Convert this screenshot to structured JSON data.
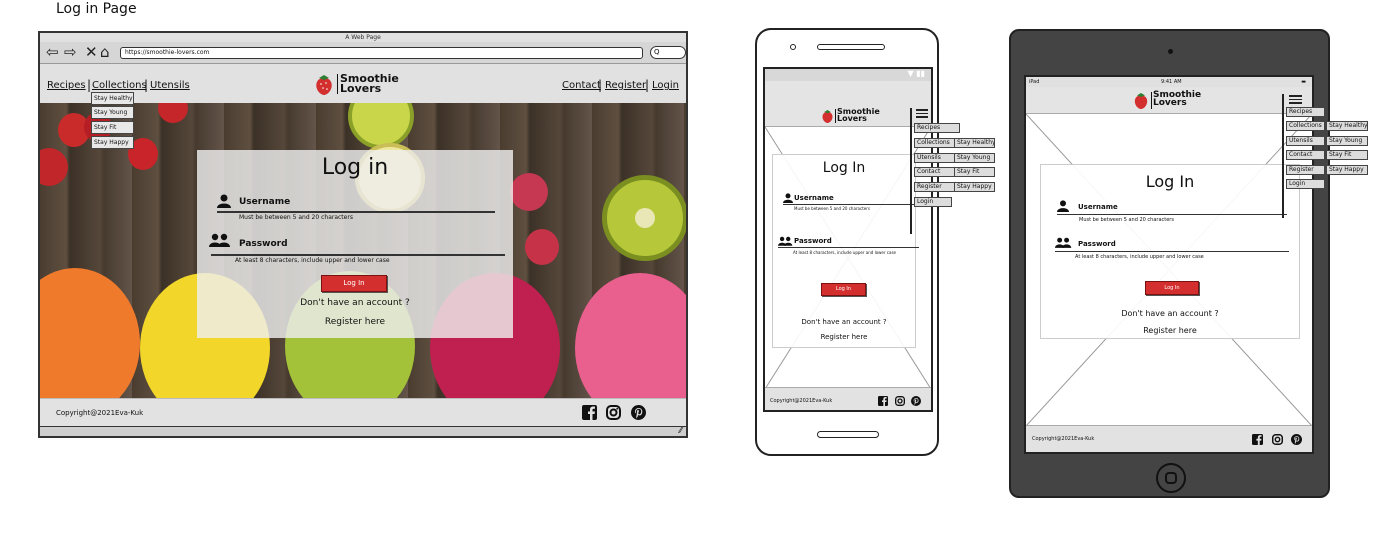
{
  "page": {
    "heading": "Log in Page"
  },
  "desktop": {
    "window_title": "A Web Page",
    "url": "https://smoothie-lovers.com",
    "search_glyph": "Q",
    "nav_left": [
      "Recipes",
      "Collections",
      "Utensils"
    ],
    "nav_right": [
      "Contact",
      "Register",
      "Login"
    ],
    "logo_line1": "Smoothie",
    "logo_line2": "Lovers",
    "submenu": [
      "Stay Healthy",
      "Stay Young",
      "Stay Fit",
      "Stay Happy"
    ],
    "login": {
      "title": "Log in",
      "username_label": "Username",
      "username_hint": "Must be between 5 and 20 characters",
      "password_label": "Password",
      "password_hint": "At least 8 characters, include upper and lower case",
      "button_label": "Log In",
      "no_account_text": "Don't have an account ?",
      "register_link": "Register here"
    },
    "footer_copyright": "Copyright@2021Eva-Kuk",
    "social_icons": [
      "facebook-icon",
      "instagram-icon",
      "pinterest-icon"
    ]
  },
  "phone": {
    "logo_line1": "Smoothie",
    "logo_line2": "Lovers",
    "menu": [
      "Recipes",
      "Collections",
      "Utensils",
      "Contact",
      "Register",
      "Login"
    ],
    "submenu": [
      "Stay Healthy",
      "Stay Young",
      "Stay Fit",
      "Stay Happy"
    ],
    "login": {
      "title": "Log In",
      "username_label": "Username",
      "username_hint": "Must be between 5 and 20 characters",
      "password_label": "Password",
      "password_hint": "At least 8 characters, include upper and lower case",
      "button_label": "Log In",
      "no_account_text": "Don't have an account ?",
      "register_link": "Register here"
    },
    "footer_copyright": "Copyright@2021Eva-Kuk"
  },
  "tablet": {
    "status_left": "iPad",
    "status_time": "9:41 AM",
    "logo_line1": "Smoothie",
    "logo_line2": "Lovers",
    "menu": [
      "Recipes",
      "Collections",
      "Utensils",
      "Contact",
      "Register",
      "Login"
    ],
    "submenu": [
      "Stay Healthy",
      "Stay Young",
      "Stay Fit",
      "Stay Happy"
    ],
    "login": {
      "title": "Log In",
      "username_label": "Username",
      "username_hint": "Must be between 5 and 20 characters",
      "password_label": "Password",
      "password_hint": "At least 8 characters, include upper and lower case",
      "button_label": "Log In",
      "no_account_text": "Don't have an account ?",
      "register_link": "Register here"
    },
    "footer_copyright": "Copyright@2021Eva-Kuk"
  },
  "colors": {
    "accent_red": "#d32f2f",
    "frame_dark": "#444444",
    "nav_bg": "#e1e1e1"
  }
}
